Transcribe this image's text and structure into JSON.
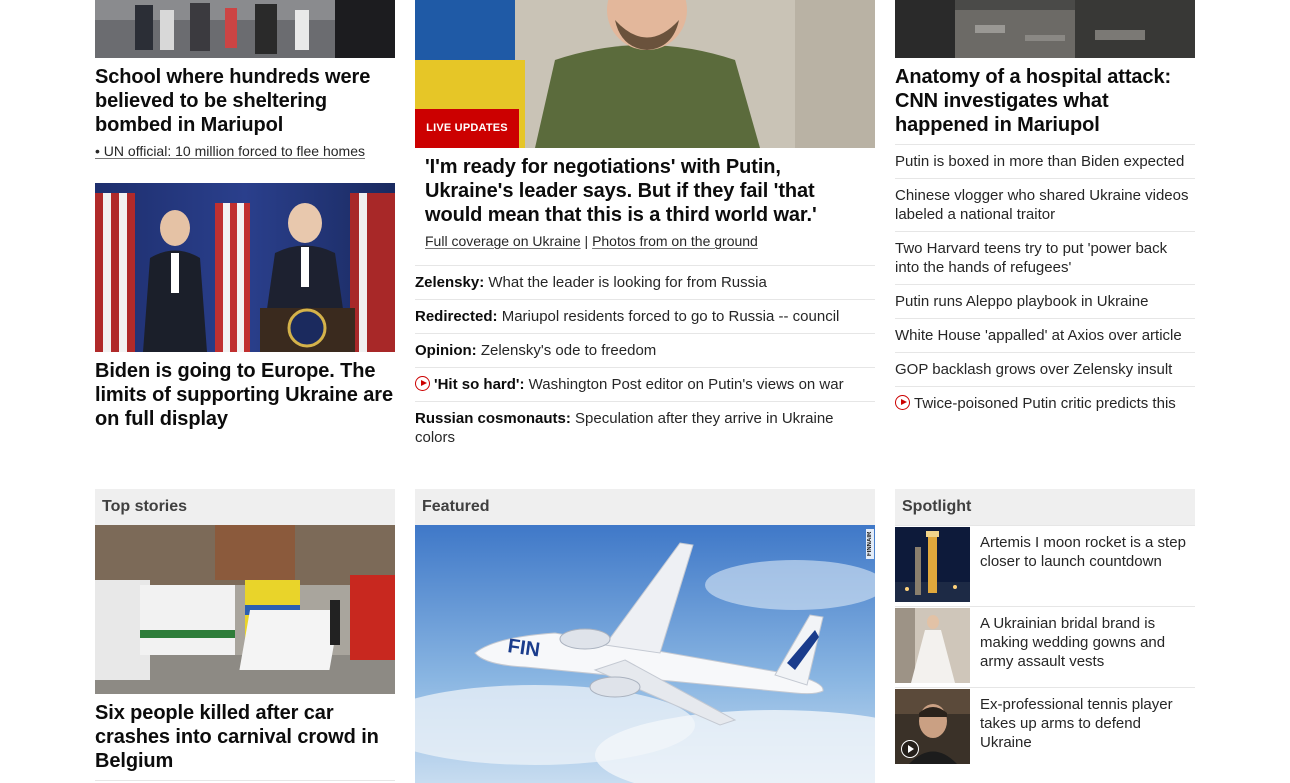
{
  "left": {
    "story1": {
      "headline": "School where hundreds were believed to be sheltering bombed in Mariupol",
      "sublink": "• UN official: 10 million forced to flee homes"
    },
    "story2": {
      "headline": "Biden is going to Europe. The limits of supporting Ukraine are on full display"
    }
  },
  "middle": {
    "badge": "LIVE UPDATES",
    "headline": "'I'm ready for negotiations' with Putin, Ukraine's leader says. But if they fail 'that would mean that this is a third world war.'",
    "links": [
      "Full coverage on Ukraine",
      "|",
      "Photos from on the ground"
    ],
    "items": [
      {
        "label": "Zelensky:",
        "text": "What the leader is looking for from Russia",
        "video": false
      },
      {
        "label": "Redirected:",
        "text": "Mariupol residents forced to go to Russia -- council",
        "video": false
      },
      {
        "label": "Opinion:",
        "text": "Zelensky's ode to freedom",
        "video": false
      },
      {
        "label": "'Hit so hard':",
        "text": "Washington Post editor on Putin's views on war",
        "video": true
      },
      {
        "label": "Russian cosmonauts:",
        "text": "Speculation after they arrive in Ukraine colors",
        "video": false
      }
    ]
  },
  "right": {
    "headline": "Anatomy of a hospital attack: CNN investigates what happened in Mariupol",
    "items": [
      {
        "text": "Putin is boxed in more than Biden expected",
        "video": false
      },
      {
        "text": "Chinese vlogger who shared Ukraine videos labeled a national traitor",
        "video": false
      },
      {
        "text": "Two Harvard teens try to put 'power back into the hands of refugees'",
        "video": false
      },
      {
        "text": "Putin runs Aleppo playbook in Ukraine",
        "video": false
      },
      {
        "text": "White House 'appalled' at Axios over article",
        "video": false
      },
      {
        "text": "GOP backlash grows over Zelensky insult",
        "video": false
      },
      {
        "text": "Twice-poisoned Putin critic predicts this",
        "video": true
      }
    ]
  },
  "sections": {
    "top_stories": {
      "title": "Top stories",
      "headline": "Six people killed after car crashes into carnival crowd in Belgium"
    },
    "featured": {
      "title": "Featured",
      "watermark": "FINNAIR"
    },
    "spotlight": {
      "title": "Spotlight",
      "items": [
        {
          "text": "Artemis I moon rocket is a step closer to launch countdown",
          "video": false
        },
        {
          "text": "A Ukrainian bridal brand is making wedding gowns and army assault vests",
          "video": false
        },
        {
          "text": "Ex-professional tennis player takes up arms to defend Ukraine",
          "video": true
        }
      ]
    }
  },
  "colors": {
    "accent_red": "#cc0000",
    "section_bg": "#efefef",
    "text": "#0c0c0c"
  }
}
